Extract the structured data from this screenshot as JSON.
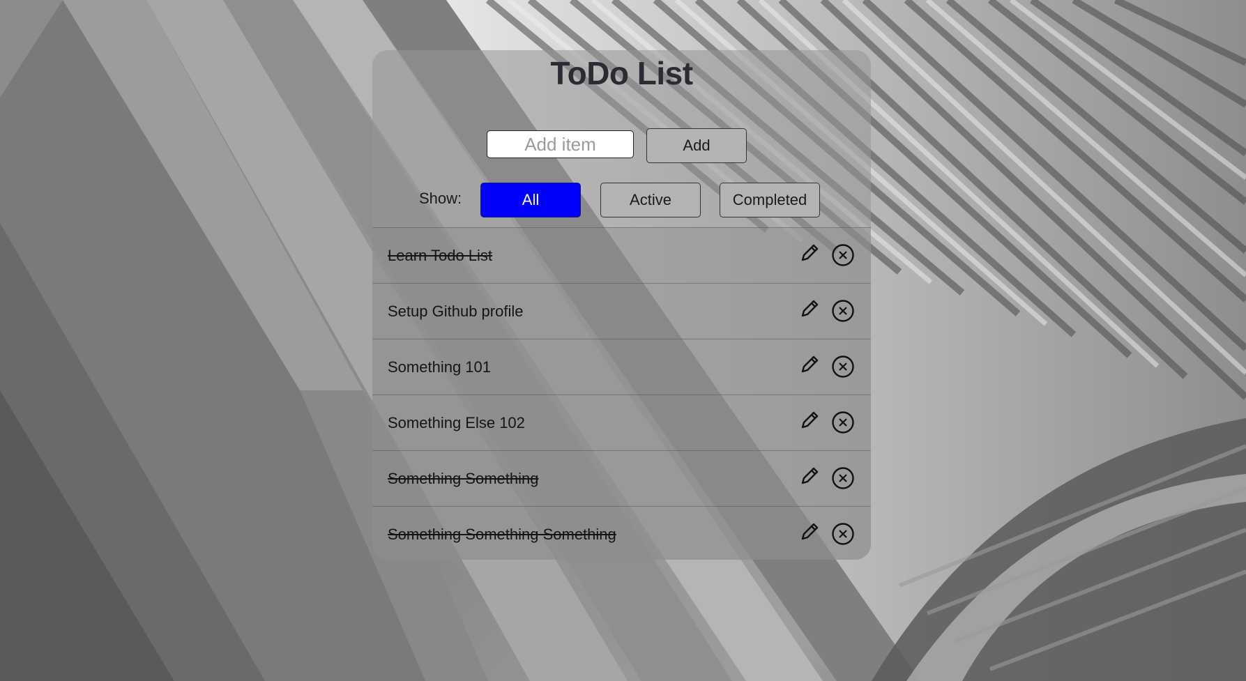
{
  "app": {
    "title": "ToDo List"
  },
  "add_form": {
    "placeholder": "Add item",
    "value": "",
    "button_label": "Add"
  },
  "filters": {
    "label": "Show:",
    "options": [
      "All",
      "Active",
      "Completed"
    ],
    "selected": "All"
  },
  "todos": [
    {
      "text": "Learn Todo List",
      "completed": true
    },
    {
      "text": "Setup Github profile",
      "completed": false
    },
    {
      "text": "Something 101",
      "completed": false
    },
    {
      "text": "Something Else 102",
      "completed": false
    },
    {
      "text": "Something Something",
      "completed": true
    },
    {
      "text": "Something Something Something",
      "completed": true
    }
  ],
  "icons": {
    "edit": "pencil-icon",
    "delete": "close-circle-icon"
  },
  "colors": {
    "active_filter_bg": "#0000ff",
    "active_filter_text": "#ffffff",
    "button_bg": "#b3b3b3",
    "title_text": "#2b2b33"
  }
}
